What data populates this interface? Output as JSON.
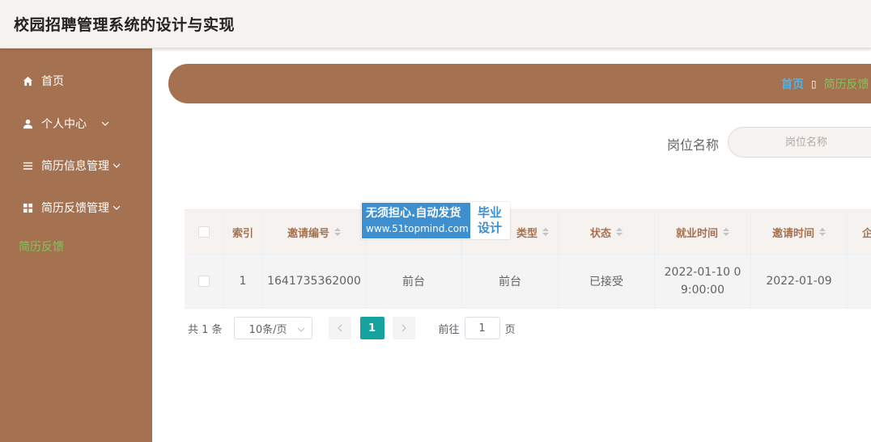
{
  "header": {
    "title": "校园招聘管理系统的设计与实现"
  },
  "sidebar": {
    "items": [
      {
        "label": "首页",
        "icon": "home-icon"
      },
      {
        "label": "个人中心",
        "icon": "user-icon"
      },
      {
        "label": "简历信息管理",
        "icon": "list-icon"
      },
      {
        "label": "简历反馈管理",
        "icon": "grid-icon"
      }
    ],
    "active_sub": "简历反馈"
  },
  "breadcrumb": {
    "home": "首页",
    "current": "简历反馈"
  },
  "search": {
    "label": "岗位名称",
    "placeholder": "岗位名称"
  },
  "table": {
    "headers": [
      "索引",
      "邀请编号",
      "",
      "类型",
      "状态",
      "就业时间",
      "邀请时间",
      "企"
    ],
    "rows": [
      {
        "index": "1",
        "invite_no": "1641735362000",
        "position": "前台",
        "type": "前台",
        "status": "已接受",
        "work_time": "2022-01-10 09:00:00",
        "invite_time": "2022-01-09"
      }
    ]
  },
  "watermark": {
    "line1": "无须担心.自动发货",
    "line2": "www.51topmind.com",
    "tag1": "毕业",
    "tag2": "设计"
  },
  "pagination": {
    "total": "共 1 条",
    "page_size": "10条/页",
    "current": "1",
    "goto_label": "前往",
    "goto_value": "1",
    "page_unit": "页"
  },
  "colors": {
    "sidebar": "#a57251",
    "accent_green": "#7ec65a",
    "accent_blue": "#4fb3e8",
    "page_active": "#16a3a0"
  }
}
